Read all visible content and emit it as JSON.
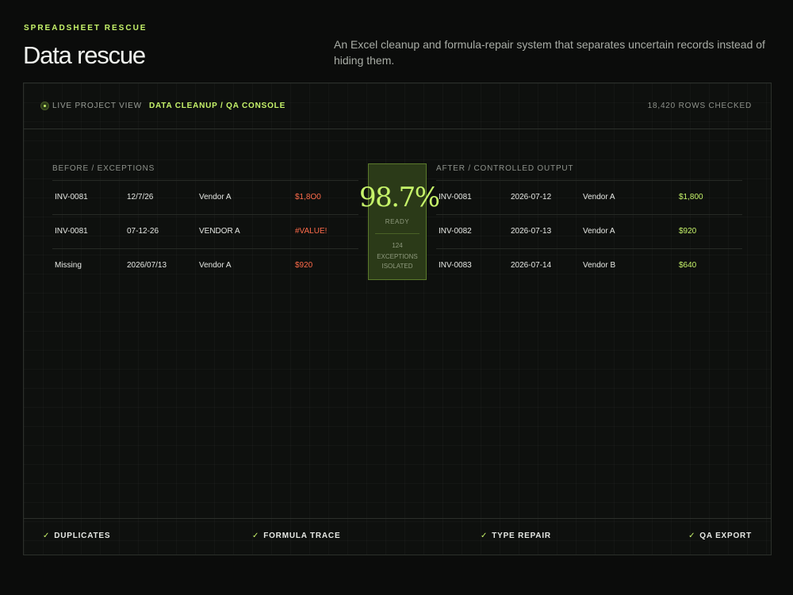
{
  "header": {
    "eyebrow": "SPREADSHEET RESCUE",
    "title": "Data rescue",
    "intro": "An Excel cleanup and formula-repair system that separates uncertain records instead of hiding them."
  },
  "console": {
    "live_label": "LIVE PROJECT VIEW",
    "console_label": "DATA CLEANUP / QA CONSOLE",
    "rows_checked": "18,420 ROWS CHECKED"
  },
  "before": {
    "label": "BEFORE / EXCEPTIONS",
    "rows": [
      [
        "INV-0081",
        "12/7/26",
        "Vendor A",
        "$1,8O0"
      ],
      [
        "INV-0081",
        "07-12-26",
        "VENDOR A",
        "#VALUE!"
      ],
      [
        "Missing",
        "2026/07/13",
        "Vendor A",
        "$920"
      ]
    ]
  },
  "after": {
    "label": "AFTER / CONTROLLED OUTPUT",
    "rows": [
      [
        "INV-0081",
        "2026-07-12",
        "Vendor A",
        "$1,800"
      ],
      [
        "INV-0082",
        "2026-07-13",
        "Vendor A",
        "$920"
      ],
      [
        "INV-0083",
        "2026-07-14",
        "Vendor B",
        "$640"
      ]
    ]
  },
  "score": {
    "value": "98.7%",
    "status": "READY",
    "exceptions_count": "124",
    "exceptions_note": "EXCEPTIONS ISOLATED"
  },
  "footer": {
    "tick": "✓",
    "checks": [
      "DUPLICATES",
      "FORMULA TRACE",
      "TYPE REPAIR",
      "QA EXPORT"
    ]
  },
  "colors": {
    "accent": "#c6f36a",
    "error": "#ff6b4a",
    "background": "#0b0c0b"
  }
}
